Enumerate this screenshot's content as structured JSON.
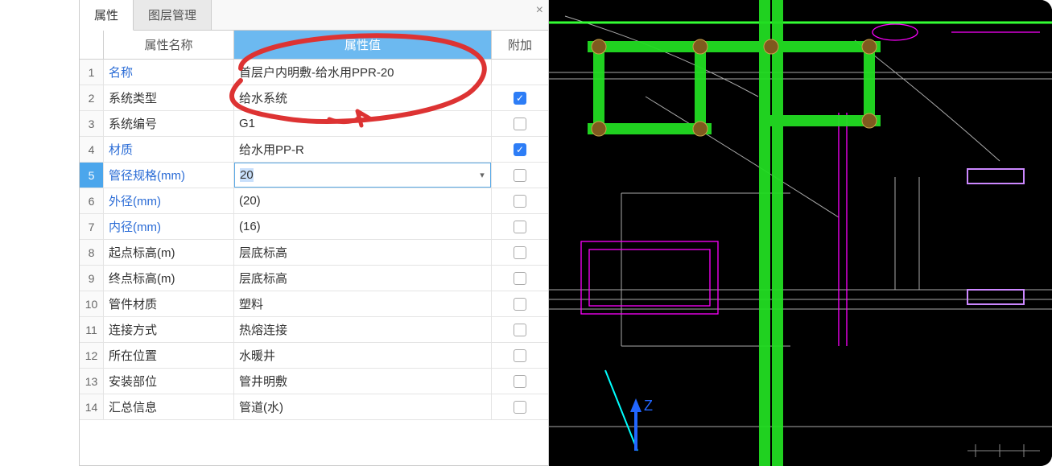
{
  "tabs": {
    "active": "属性",
    "inactive": "图层管理"
  },
  "header": {
    "name": "属性名称",
    "value": "属性值",
    "addon": "附加"
  },
  "rows": [
    {
      "n": "1",
      "name": "名称",
      "link": true,
      "value": "首层户内明敷-给水用PPR-20",
      "chk": "none"
    },
    {
      "n": "2",
      "name": "系统类型",
      "link": false,
      "value": "给水系统",
      "chk": "on"
    },
    {
      "n": "3",
      "name": "系统编号",
      "link": false,
      "value": "G1",
      "chk": "off"
    },
    {
      "n": "4",
      "name": "材质",
      "link": true,
      "value": "给水用PP-R",
      "chk": "on"
    },
    {
      "n": "5",
      "name": "管径规格(mm)",
      "link": true,
      "value": "20",
      "chk": "off",
      "editing": true
    },
    {
      "n": "6",
      "name": "外径(mm)",
      "link": true,
      "value": "(20)",
      "chk": "off"
    },
    {
      "n": "7",
      "name": "内径(mm)",
      "link": true,
      "value": "(16)",
      "chk": "off"
    },
    {
      "n": "8",
      "name": "起点标高(m)",
      "link": false,
      "value": "层底标高",
      "chk": "off"
    },
    {
      "n": "9",
      "name": "终点标高(m)",
      "link": false,
      "value": "层底标高",
      "chk": "off"
    },
    {
      "n": "10",
      "name": "管件材质",
      "link": false,
      "value": "塑料",
      "chk": "off"
    },
    {
      "n": "11",
      "name": "连接方式",
      "link": false,
      "value": "热熔连接",
      "chk": "off"
    },
    {
      "n": "12",
      "name": "所在位置",
      "link": false,
      "value": "水暖井",
      "chk": "off"
    },
    {
      "n": "13",
      "name": "安装部位",
      "link": false,
      "value": "管井明敷",
      "chk": "off"
    },
    {
      "n": "14",
      "name": "汇总信息",
      "link": false,
      "value": "管道(水)",
      "chk": "off"
    }
  ],
  "axis": {
    "z": "Z"
  }
}
